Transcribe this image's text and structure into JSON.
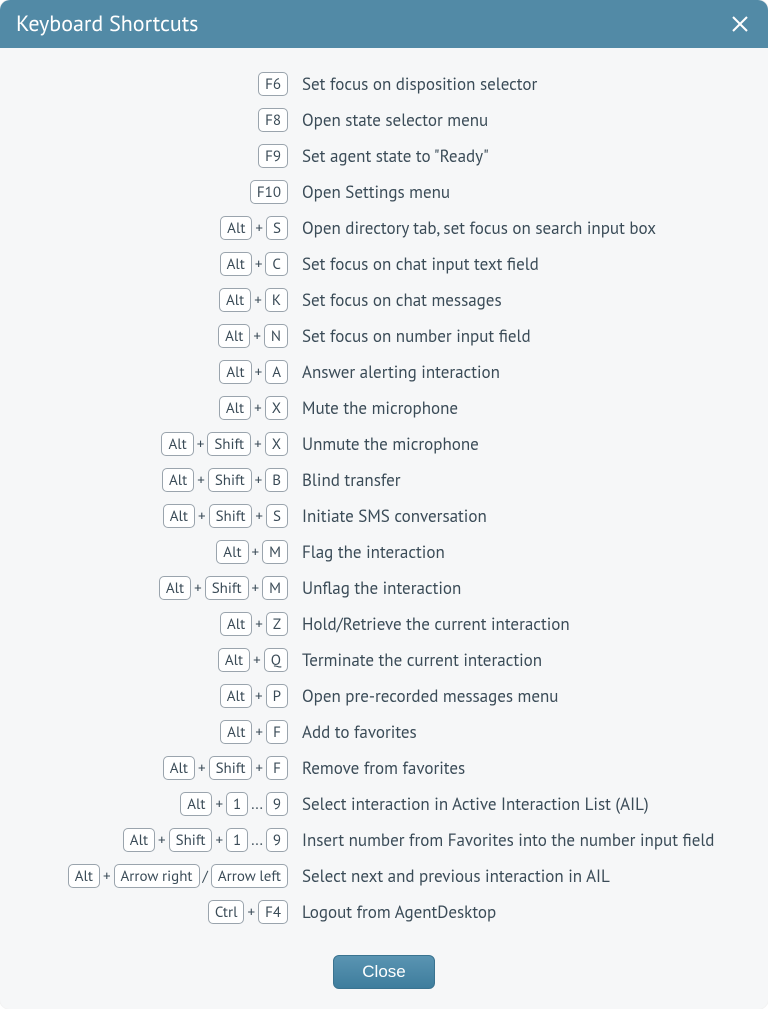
{
  "dialog": {
    "title": "Keyboard Shortcuts",
    "close_button_label": "Close"
  },
  "shortcuts": [
    {
      "keys": [
        [
          "F6"
        ]
      ],
      "desc": "Set focus on disposition selector"
    },
    {
      "keys": [
        [
          "F8"
        ]
      ],
      "desc": "Open state selector menu"
    },
    {
      "keys": [
        [
          "F9"
        ]
      ],
      "desc": "Set agent state to \"Ready\""
    },
    {
      "keys": [
        [
          "F10"
        ]
      ],
      "desc": "Open Settings menu"
    },
    {
      "keys": [
        [
          "Alt",
          "S"
        ]
      ],
      "desc": "Open directory tab, set focus on search input box"
    },
    {
      "keys": [
        [
          "Alt",
          "C"
        ]
      ],
      "desc": "Set focus on chat input text field"
    },
    {
      "keys": [
        [
          "Alt",
          "K"
        ]
      ],
      "desc": "Set focus on chat messages"
    },
    {
      "keys": [
        [
          "Alt",
          "N"
        ]
      ],
      "desc": "Set focus on number input field"
    },
    {
      "keys": [
        [
          "Alt",
          "A"
        ]
      ],
      "desc": "Answer alerting interaction"
    },
    {
      "keys": [
        [
          "Alt",
          "X"
        ]
      ],
      "desc": "Mute the microphone"
    },
    {
      "keys": [
        [
          "Alt",
          "Shift",
          "X"
        ]
      ],
      "desc": "Unmute the microphone"
    },
    {
      "keys": [
        [
          "Alt",
          "Shift",
          "B"
        ]
      ],
      "desc": "Blind transfer"
    },
    {
      "keys": [
        [
          "Alt",
          "Shift",
          "S"
        ]
      ],
      "desc": "Initiate SMS conversation"
    },
    {
      "keys": [
        [
          "Alt",
          "M"
        ]
      ],
      "desc": "Flag the interaction"
    },
    {
      "keys": [
        [
          "Alt",
          "Shift",
          "M"
        ]
      ],
      "desc": "Unflag the interaction"
    },
    {
      "keys": [
        [
          "Alt",
          "Z"
        ]
      ],
      "desc": "Hold/Retrieve the current interaction"
    },
    {
      "keys": [
        [
          "Alt",
          "Q"
        ]
      ],
      "desc": "Terminate the current interaction"
    },
    {
      "keys": [
        [
          "Alt",
          "P"
        ]
      ],
      "desc": "Open pre-recorded messages menu"
    },
    {
      "keys": [
        [
          "Alt",
          "F"
        ]
      ],
      "desc": "Add to favorites"
    },
    {
      "keys": [
        [
          "Alt",
          "Shift",
          "F"
        ]
      ],
      "desc": "Remove from favorites"
    },
    {
      "keys": [
        [
          "Alt",
          "1"
        ]
      ],
      "range_to": "9",
      "desc": "Select interaction in Active Interaction List (AIL)"
    },
    {
      "keys": [
        [
          "Alt",
          "Shift",
          "1"
        ]
      ],
      "range_to": "9",
      "desc": "Insert number from Favorites into the number input field"
    },
    {
      "keys": [
        [
          "Alt",
          "Arrow right"
        ],
        [
          "Arrow left"
        ]
      ],
      "desc": "Select next and previous interaction in AIL"
    },
    {
      "keys": [
        [
          "Ctrl",
          "F4"
        ]
      ],
      "desc": "Logout from AgentDesktop"
    }
  ]
}
